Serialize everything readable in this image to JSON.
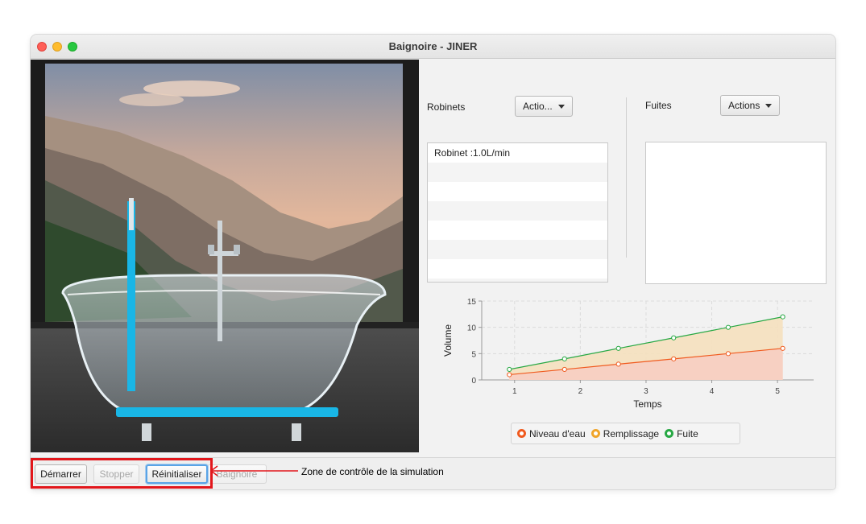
{
  "window": {
    "title": "Baignoire - JINER"
  },
  "robinets": {
    "label": "Robinets",
    "actions_label": "Actio...",
    "items": [
      "Robinet :1.0L/min"
    ]
  },
  "fuites": {
    "label": "Fuites",
    "actions_label": "Actions",
    "items": []
  },
  "controls": {
    "start_label": "Démarrer",
    "stop_label": "Stopper",
    "reset_label": "Réinitialiser",
    "bathtub_label": "Baignoire"
  },
  "annotation": "Zone de contrôle de la simulation",
  "colors": {
    "niveau": "#f05a1e",
    "remplissage": "#f0a52a",
    "fuite": "#27a844",
    "water": "#19b6e6",
    "highlight": "#e2161b"
  },
  "chart_data": {
    "type": "area",
    "xlabel": "Temps",
    "ylabel": "Volume",
    "xlim": [
      0.5,
      5.55
    ],
    "ylim": [
      0,
      15
    ],
    "xticks": [
      1,
      2,
      3,
      4,
      5
    ],
    "yticks": [
      0,
      5,
      10,
      15
    ],
    "grid": true,
    "legend_position": "bottom",
    "series": [
      {
        "name": "Niveau d'eau",
        "color_key": "niveau",
        "x": [
          0.92,
          1.76,
          2.58,
          3.42,
          4.25,
          5.08
        ],
        "y": [
          1,
          2,
          3,
          4,
          5,
          6
        ]
      },
      {
        "name": "Remplissage",
        "color_key": "remplissage",
        "x": [],
        "y": []
      },
      {
        "name": "Fuite",
        "color_key": "fuite",
        "x": [
          0.92,
          1.76,
          2.58,
          3.42,
          4.25,
          5.08
        ],
        "y": [
          2,
          4,
          6,
          8,
          10,
          12
        ]
      }
    ]
  }
}
